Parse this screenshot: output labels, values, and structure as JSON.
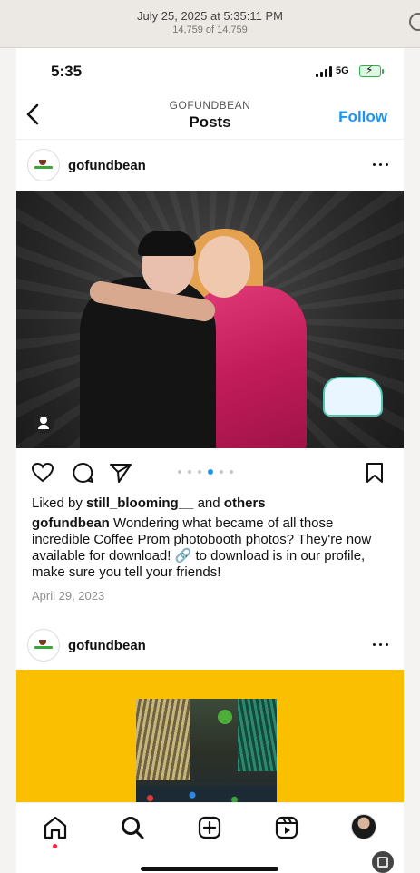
{
  "viewer": {
    "date": "July 25, 2025 at 5:35:11 PM",
    "count": "14,759 of 14,759"
  },
  "status_bar": {
    "time": "5:35",
    "network": "5G"
  },
  "nav": {
    "kicker": "GOFUNDBEAN",
    "title": "Posts",
    "follow_label": "Follow"
  },
  "post1": {
    "username": "gofundbean",
    "liked_prefix": "Liked by ",
    "liked_user": "still_blooming__",
    "liked_mid": " and ",
    "liked_suffix": "others",
    "caption_user": "gofundbean",
    "caption_text": " Wondering what became of all those incredible Coffee Prom photobooth photos? They're now available for download! 🔗 to download is in our profile, make sure you tell your friends!",
    "date": "April 29, 2023",
    "carousel_active_index": 3,
    "carousel_count": 6
  },
  "post2": {
    "username": "gofundbean"
  },
  "colors": {
    "accent": "#1d95f0",
    "post2_background": "#fac000",
    "notification": "#ff1f3d"
  },
  "icons": {
    "back": "chevron-left-icon",
    "more": "more-horizontal-icon",
    "like": "heart-icon",
    "comment": "comment-icon",
    "share": "send-icon",
    "save": "bookmark-icon",
    "tags": "user-tag-icon",
    "home": "home-icon",
    "search": "search-icon",
    "create": "plus-square-icon",
    "reels": "reels-icon"
  }
}
